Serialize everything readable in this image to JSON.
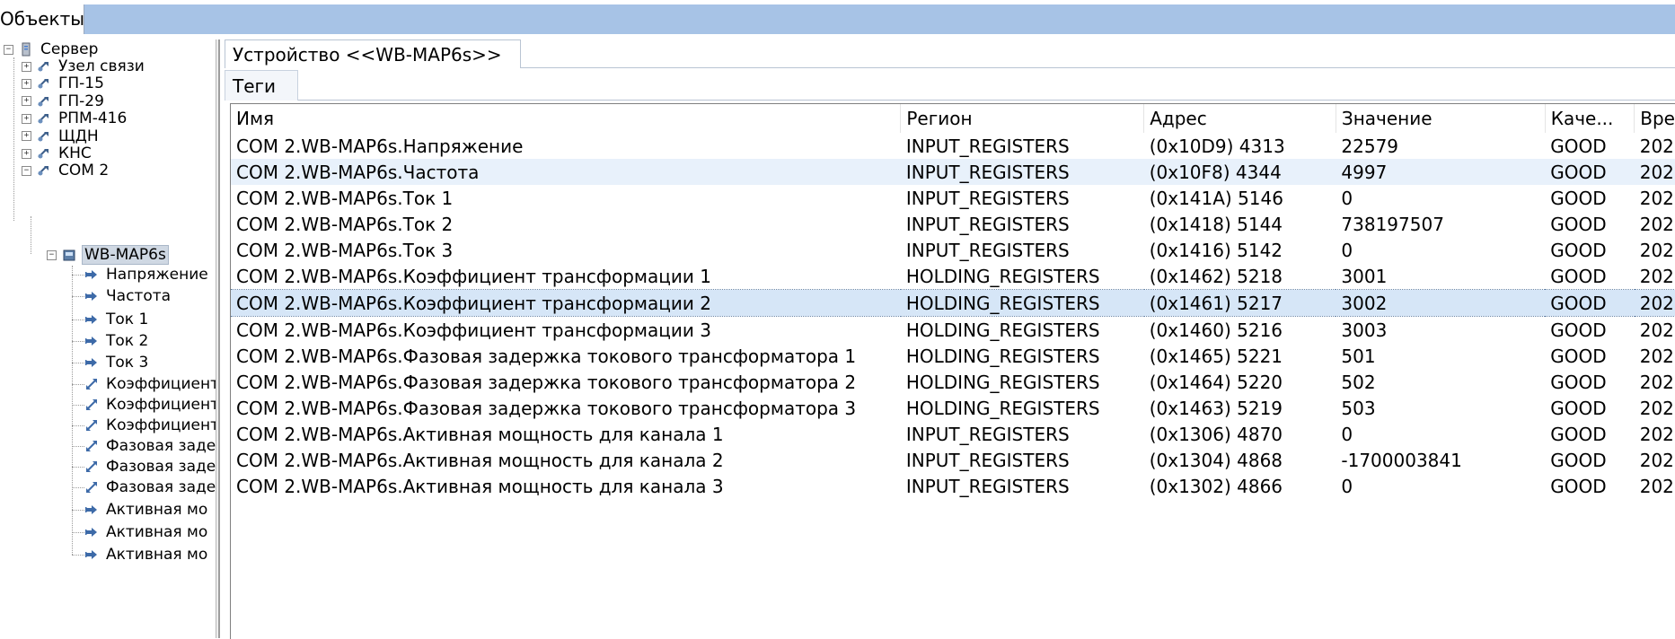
{
  "objects_tab": "Объекты",
  "tree": {
    "server": "Сервер",
    "nodes": [
      "Узел связи",
      "ГП-15",
      "ГП-29",
      "РПМ-416",
      "ЩДН",
      "КНС",
      "COM 2"
    ],
    "device": "WB-MAP6s",
    "tags": [
      "Напряжение",
      "Частота",
      "Ток 1",
      "Ток 2",
      "Ток 3",
      "Коэффициент",
      "Коэффициент",
      "Коэффициент",
      "Фазовая заде",
      "Фазовая заде",
      "Фазовая заде",
      "Активная мо",
      "Активная мо",
      "Активная мо"
    ]
  },
  "device_tab": "Устройство <<WB-MAP6s>>",
  "tags_tab": "Теги",
  "columns": [
    "Имя",
    "Регион",
    "Адрес",
    "Значение",
    "Каче...",
    "Вре"
  ],
  "rows": [
    [
      "COM 2.WB-MAP6s.Напряжение",
      "INPUT_REGISTERS",
      "(0x10D9) 4313",
      "22579",
      "GOOD",
      "202"
    ],
    [
      "COM 2.WB-MAP6s.Частота",
      "INPUT_REGISTERS",
      "(0x10F8) 4344",
      "4997",
      "GOOD",
      "202"
    ],
    [
      "COM 2.WB-MAP6s.Ток 1",
      "INPUT_REGISTERS",
      "(0x141A) 5146",
      "0",
      "GOOD",
      "202"
    ],
    [
      "COM 2.WB-MAP6s.Ток 2",
      "INPUT_REGISTERS",
      "(0x1418) 5144",
      "738197507",
      "GOOD",
      "202"
    ],
    [
      "COM 2.WB-MAP6s.Ток 3",
      "INPUT_REGISTERS",
      "(0x1416) 5142",
      "0",
      "GOOD",
      "202"
    ],
    [
      "COM 2.WB-MAP6s.Коэффициент трансформации 1",
      "HOLDING_REGISTERS",
      "(0x1462) 5218",
      "3001",
      "GOOD",
      "202"
    ],
    [
      "COM 2.WB-MAP6s.Коэффициент трансформации 2",
      "HOLDING_REGISTERS",
      "(0x1461) 5217",
      "3002",
      "GOOD",
      "202"
    ],
    [
      "COM 2.WB-MAP6s.Коэффициент трансформации 3",
      "HOLDING_REGISTERS",
      "(0x1460) 5216",
      "3003",
      "GOOD",
      "202"
    ],
    [
      "COM 2.WB-MAP6s.Фазовая задержка токового трансформатора 1",
      "HOLDING_REGISTERS",
      "(0x1465) 5221",
      "501",
      "GOOD",
      "202"
    ],
    [
      "COM 2.WB-MAP6s.Фазовая задержка токового трансформатора 2",
      "HOLDING_REGISTERS",
      "(0x1464) 5220",
      "502",
      "GOOD",
      "202"
    ],
    [
      "COM 2.WB-MAP6s.Фазовая задержка токового трансформатора 3",
      "HOLDING_REGISTERS",
      "(0x1463) 5219",
      "503",
      "GOOD",
      "202"
    ],
    [
      "COM 2.WB-MAP6s.Активная мощность для канала 1",
      "INPUT_REGISTERS",
      "(0x1306) 4870",
      "0",
      "GOOD",
      "202"
    ],
    [
      "COM 2.WB-MAP6s.Активная мощность для канала 2",
      "INPUT_REGISTERS",
      "(0x1304) 4868",
      "-1700003841",
      "GOOD",
      "202"
    ],
    [
      "COM 2.WB-MAP6s.Активная мощность для канала 3",
      "INPUT_REGISTERS",
      "(0x1302) 4866",
      "0",
      "GOOD",
      "202"
    ]
  ],
  "selected_row": 6,
  "hover_row": 1
}
